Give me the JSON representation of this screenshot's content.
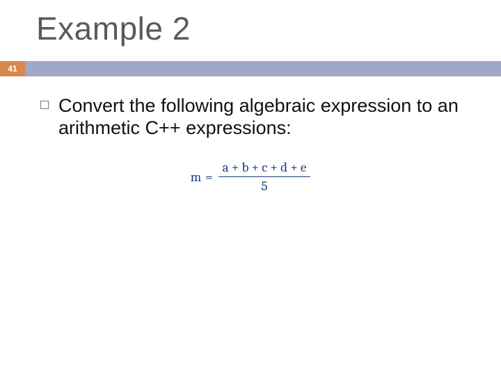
{
  "title": "Example 2",
  "badge": "41",
  "bullet": "Convert the following algebraic expression to an arithmetic  C++ expressions:",
  "equation": {
    "lhs_var": "m",
    "equals": "=",
    "numerator": "a + b + c + d + e",
    "denominator": "5"
  }
}
